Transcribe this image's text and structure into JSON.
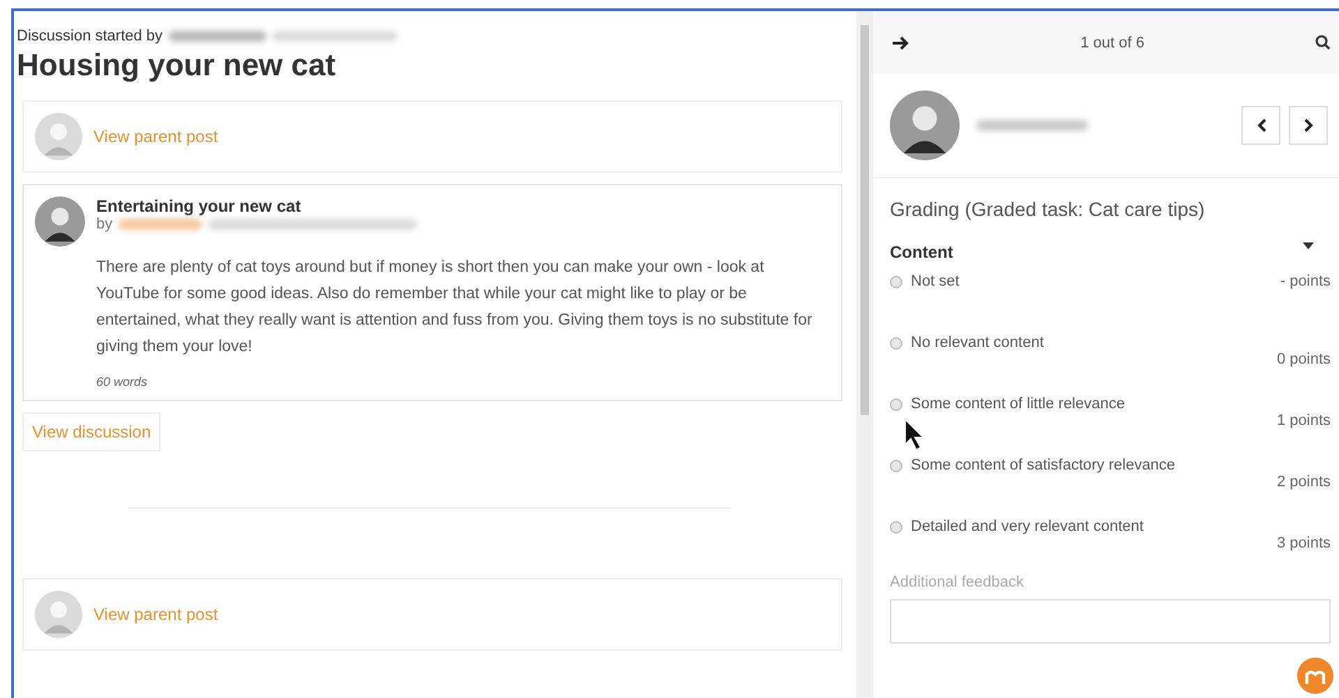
{
  "discussion": {
    "started_by": "Discussion started by",
    "title": "Housing your new cat"
  },
  "posts": [
    {
      "kind": "parent",
      "link": "View parent post"
    },
    {
      "kind": "post",
      "subject": "Entertaining your new cat",
      "by": "by",
      "body": "There are plenty of cat toys around but if  money is short then you can make your own - look at YouTube for some good ideas. Also do remember that while your cat might like to play or be entertained, what they really want is attention and fuss from you. Giving them toys is no substitute for giving them your love!",
      "word_count": "60 words"
    },
    {
      "kind": "discussion-link",
      "link": "View discussion"
    },
    {
      "kind": "divider"
    },
    {
      "kind": "parent",
      "link": "View parent post"
    }
  ],
  "grader": {
    "counter": "1 out of 6",
    "heading": "Grading (Graded task: Cat care tips)",
    "criterion": "Content",
    "options": [
      {
        "label": "Not set",
        "points": "- points",
        "selected": false
      },
      {
        "label": "No relevant content",
        "points": "0 points",
        "selected": false
      },
      {
        "label": "Some content of little relevance",
        "points": "1 points",
        "selected": false
      },
      {
        "label": "Some content of satisfactory relevance",
        "points": "2 points",
        "selected": false
      },
      {
        "label": "Detailed and very relevant content",
        "points": "3 points",
        "selected": false
      }
    ],
    "feedback_label": "Additional feedback"
  }
}
